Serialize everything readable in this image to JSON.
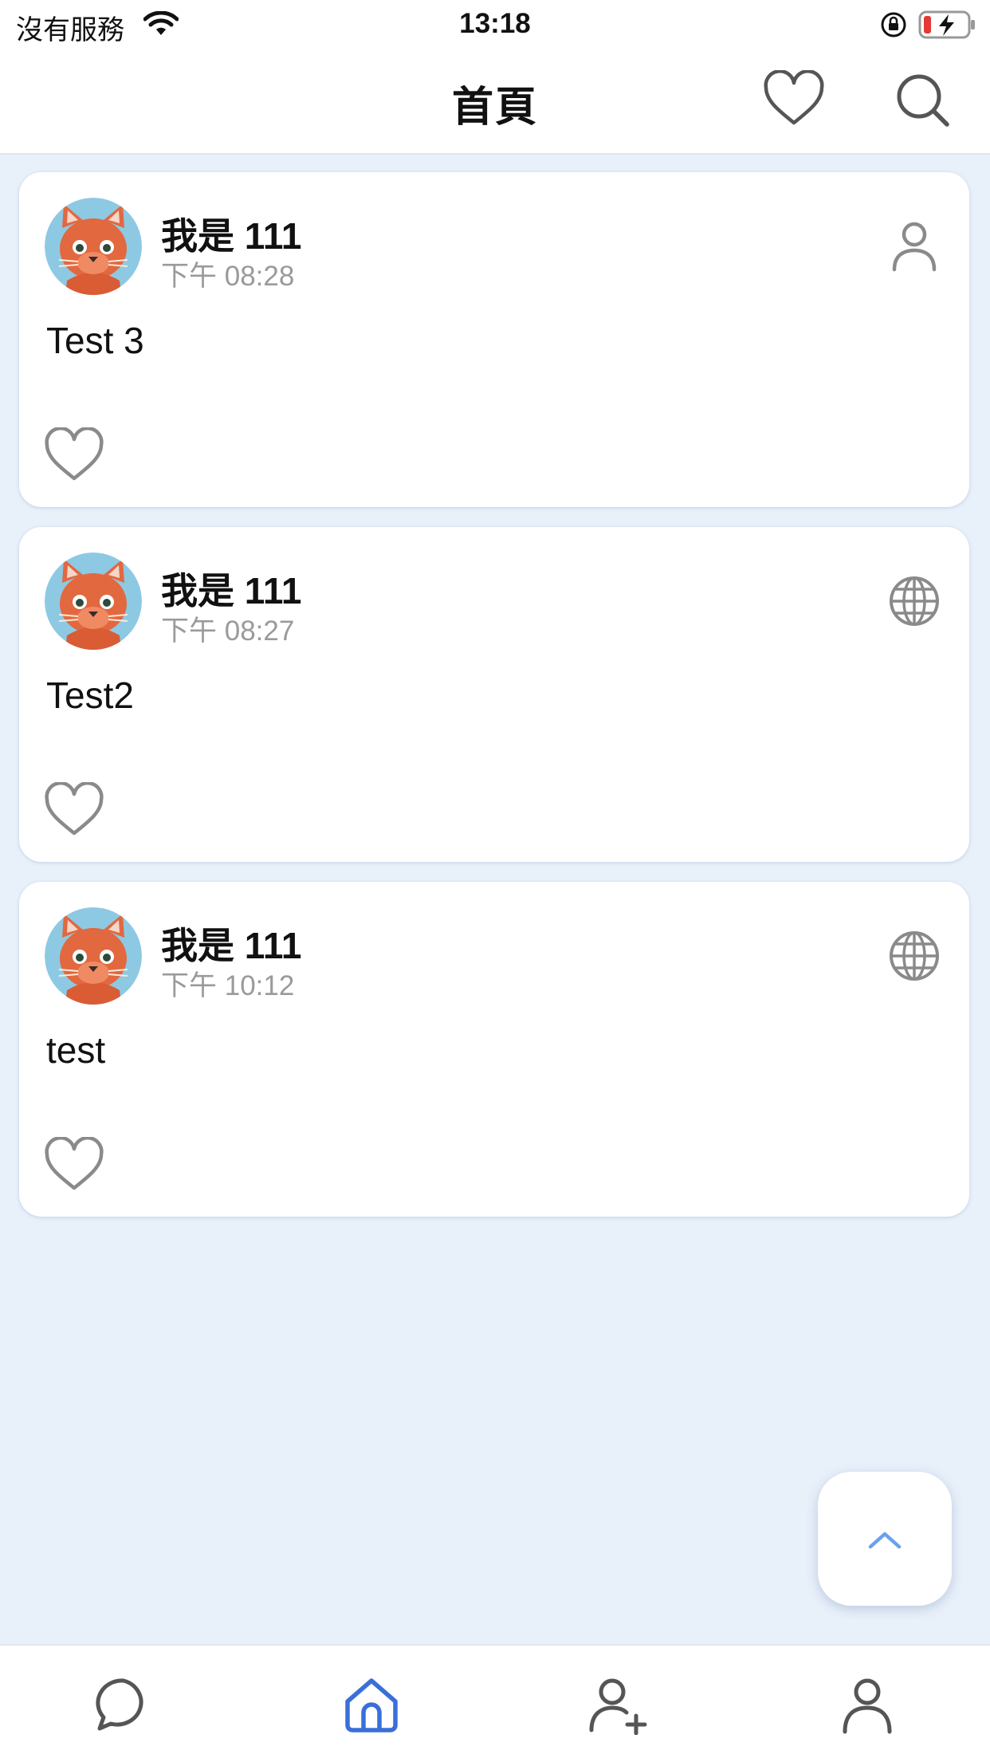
{
  "status_bar": {
    "carrier": "沒有服務",
    "time": "13:18",
    "icons": [
      "wifi-icon",
      "orientation-lock-icon",
      "battery-charging-icon"
    ]
  },
  "nav": {
    "title": "首頁",
    "icons": [
      "heart-icon",
      "search-icon"
    ]
  },
  "posts": [
    {
      "author": "我是 111",
      "time": "下午 08:28",
      "text": "Test 3",
      "visibility_icon": "person-icon"
    },
    {
      "author": "我是 111",
      "time": "下午 08:27",
      "text": "Test2",
      "visibility_icon": "globe-icon"
    },
    {
      "author": "我是 111",
      "time": "下午 10:12",
      "text": "test",
      "visibility_icon": "globe-icon"
    }
  ],
  "fab": {
    "icon": "chevron-up-icon"
  },
  "tab_bar": {
    "tabs": [
      {
        "icon": "chat-bubble-icon",
        "active": false
      },
      {
        "icon": "home-icon",
        "active": true
      },
      {
        "icon": "add-friend-icon",
        "active": false
      },
      {
        "icon": "profile-icon",
        "active": false
      }
    ]
  },
  "colors": {
    "background": "#e8f0fa",
    "accent": "#3a6fd8",
    "fab_chevron": "#6aa0f0",
    "icon_gray": "#8a8a8a",
    "meta_text": "#9a9a9a"
  }
}
